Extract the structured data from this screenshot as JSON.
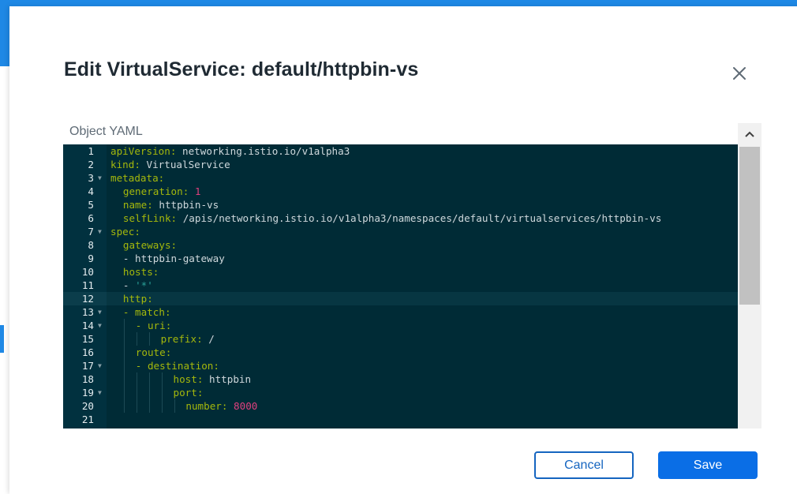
{
  "modal": {
    "title": "Edit VirtualService: default/httpbin-vs",
    "close_icon": "close-icon",
    "editor_label": "Object YAML",
    "cancel_label": "Cancel",
    "save_label": "Save"
  },
  "colors": {
    "accent": "#0a6ee6",
    "editor_bg": "#002b36",
    "yaml_key": "#a4b80c",
    "yaml_number": "#e0407e",
    "yaml_string": "#2aa198"
  },
  "editor": {
    "active_line": 12,
    "lines": [
      {
        "n": "1",
        "fold": false,
        "indent": 0,
        "key": "apiVersion:",
        "val": " networking.istio.io/v1alpha3",
        "vtype": "v"
      },
      {
        "n": "2",
        "fold": false,
        "indent": 0,
        "key": "kind:",
        "val": " VirtualService",
        "vtype": "v"
      },
      {
        "n": "3",
        "fold": true,
        "indent": 0,
        "key": "metadata:",
        "val": "",
        "vtype": "v"
      },
      {
        "n": "4",
        "fold": false,
        "indent": 1,
        "key": "generation:",
        "val": " 1",
        "vtype": "n"
      },
      {
        "n": "5",
        "fold": false,
        "indent": 1,
        "key": "name:",
        "val": " httpbin-vs",
        "vtype": "v"
      },
      {
        "n": "6",
        "fold": false,
        "indent": 1,
        "key": "selfLink:",
        "val": " /apis/networking.istio.io/v1alpha3/namespaces/default/virtualservices/httpbin-vs",
        "vtype": "v"
      },
      {
        "n": "7",
        "fold": true,
        "indent": 0,
        "key": "spec:",
        "val": "",
        "vtype": "v"
      },
      {
        "n": "8",
        "fold": false,
        "indent": 1,
        "key": "gateways:",
        "val": "",
        "vtype": "v"
      },
      {
        "n": "9",
        "fold": false,
        "indent": 1,
        "key": "",
        "val": "- httpbin-gateway",
        "vtype": "v"
      },
      {
        "n": "10",
        "fold": false,
        "indent": 1,
        "key": "hosts:",
        "val": "",
        "vtype": "v"
      },
      {
        "n": "11",
        "fold": false,
        "indent": 1,
        "key": "",
        "val": "- '*'",
        "vtype": "s"
      },
      {
        "n": "12",
        "fold": false,
        "indent": 1,
        "key": "http:",
        "val": "",
        "vtype": "v"
      },
      {
        "n": "13",
        "fold": true,
        "indent": 1,
        "key": "- match:",
        "val": "",
        "vtype": "v"
      },
      {
        "n": "14",
        "fold": true,
        "indent": 2,
        "key": "- uri:",
        "val": "",
        "vtype": "v"
      },
      {
        "n": "15",
        "fold": false,
        "indent": 4,
        "key": "prefix:",
        "val": " /",
        "vtype": "v"
      },
      {
        "n": "16",
        "fold": false,
        "indent": 2,
        "key": "route:",
        "val": "",
        "vtype": "v"
      },
      {
        "n": "17",
        "fold": true,
        "indent": 2,
        "key": "- destination:",
        "val": "",
        "vtype": "v"
      },
      {
        "n": "18",
        "fold": false,
        "indent": 5,
        "key": "host:",
        "val": " httpbin",
        "vtype": "v"
      },
      {
        "n": "19",
        "fold": true,
        "indent": 5,
        "key": "port:",
        "val": "",
        "vtype": "v"
      },
      {
        "n": "20",
        "fold": false,
        "indent": 6,
        "key": "number:",
        "val": " 8000",
        "vtype": "n"
      },
      {
        "n": "21",
        "fold": false,
        "indent": 0,
        "key": "",
        "val": "",
        "vtype": "v"
      }
    ]
  }
}
